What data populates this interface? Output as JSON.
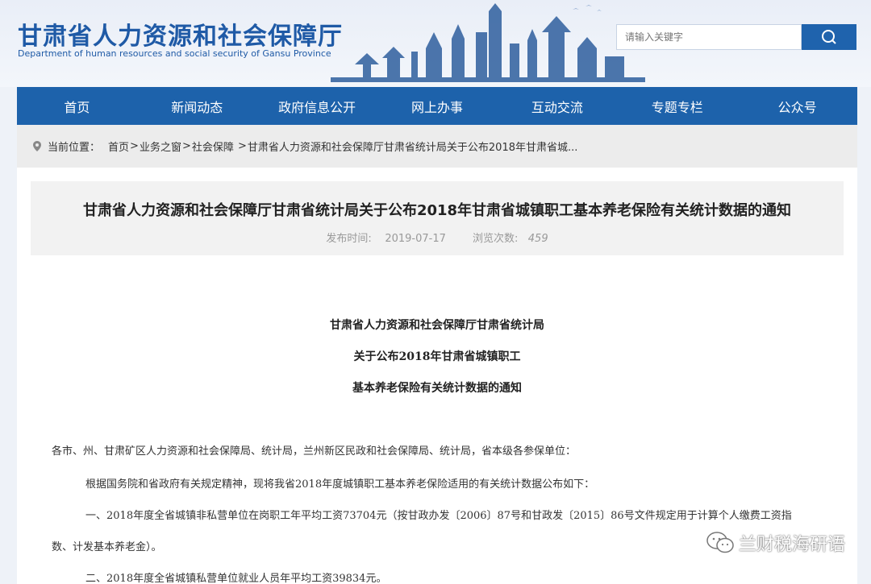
{
  "header": {
    "site_name_cn": "甘肃省人力资源和社会保障厅",
    "site_name_en": "Department of human resources and social security of Gansu Province",
    "search_placeholder": "请输入关键字"
  },
  "nav": {
    "items": [
      "首页",
      "新闻动态",
      "政府信息公开",
      "网上办事",
      "互动交流",
      "专题专栏",
      "公众号"
    ]
  },
  "breadcrumb": {
    "label": "当前位置：",
    "items": [
      "首页",
      "业务之窗",
      "社会保障",
      "甘肃省人力资源和社会保障厅甘肃省统计局关于公布2018年甘肃省城..."
    ]
  },
  "article": {
    "title": "甘肃省人力资源和社会保障厅甘肃省统计局关于公布2018年甘肃省城镇职工基本养老保险有关统计数据的通知",
    "publish_label": "发布时间:",
    "publish_date": "2019-07-17",
    "views_label": "浏览次数:",
    "views_count": "459",
    "doc_heading": [
      "甘肃省人力资源和社会保障厅甘肃省统计局",
      "关于公布2018年甘肃省城镇职工",
      "基本养老保险有关统计数据的通知"
    ],
    "paragraphs": [
      "各市、州、甘肃矿区人力资源和社会保障局、统计局，兰州新区民政和社会保障局、统计局，省本级各参保单位：",
      "根据国务院和省政府有关规定精神，现将我省2018年度城镇职工基本养老保险适用的有关统计数据公布如下：",
      "一、2018年度全省城镇非私营单位在岗职工年平均工资73704元（按甘政办发〔2006〕87号和甘政发〔2015〕86号文件规定用于计算个人缴费工资指",
      "数、计发基本养老金）。",
      "二、2018年度全省城镇私营单位就业人员年平均工资39834元。"
    ]
  },
  "watermark": {
    "text": "兰财税海研语"
  },
  "colors": {
    "brand_blue": "#1d62ab",
    "logo_blue": "#1f5aa6"
  }
}
